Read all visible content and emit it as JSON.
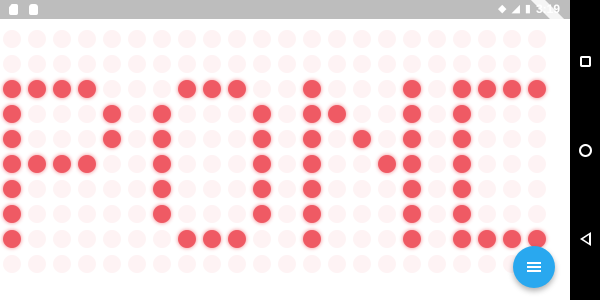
{
  "status_bar": {
    "time": "3:19",
    "icons": [
      "sd-card-icon",
      "android-icon",
      "wifi-icon",
      "signal-icon",
      "battery-icon"
    ]
  },
  "display": {
    "text": "PONG",
    "on_color": "#ef5a64",
    "rows": [
      "0000000000000000000000",
      "0000000000000000000000",
      "1111000111001000101111",
      "1000101000101100101000",
      "1000101000101010101000",
      "1111001000101001101000",
      "1000001000101000101000",
      "1000001000101000101000",
      "1000000111001000101111",
      "0000000000000000000000"
    ]
  },
  "fab": {
    "icon": "menu-icon",
    "color": "#29a8ef"
  },
  "nav_bar": {
    "buttons": [
      "recents-icon",
      "home-icon",
      "back-icon"
    ]
  }
}
